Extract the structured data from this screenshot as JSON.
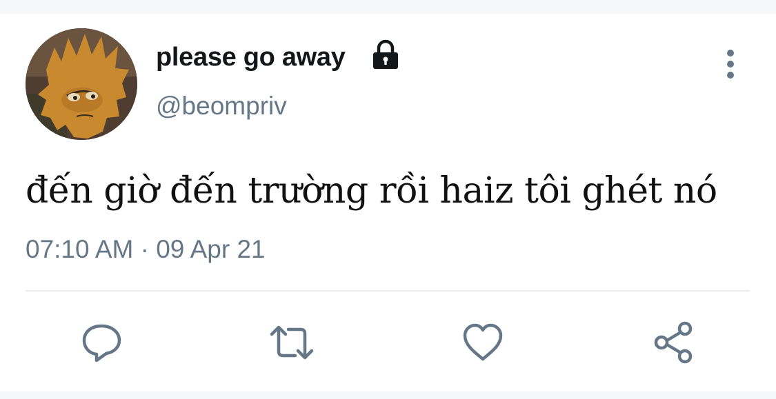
{
  "tweet": {
    "display_name": "please go away",
    "handle": "@beompriv",
    "text": "đến giờ đến trường rồi haiz tôi ghét nó",
    "timestamp": "07:10 AM · 09 Apr 21",
    "account_protected": true
  },
  "icons": {
    "lock": "lock-icon",
    "more": "more-vertical-icon",
    "reply": "reply-icon",
    "retweet": "retweet-icon",
    "like": "heart-icon",
    "share": "share-icon"
  },
  "colors": {
    "text_primary": "#14171a",
    "text_secondary": "#657786",
    "icon_gray": "#657786",
    "divider": "#e6ecf0",
    "background": "#f5f7f9",
    "card": "#ffffff"
  }
}
